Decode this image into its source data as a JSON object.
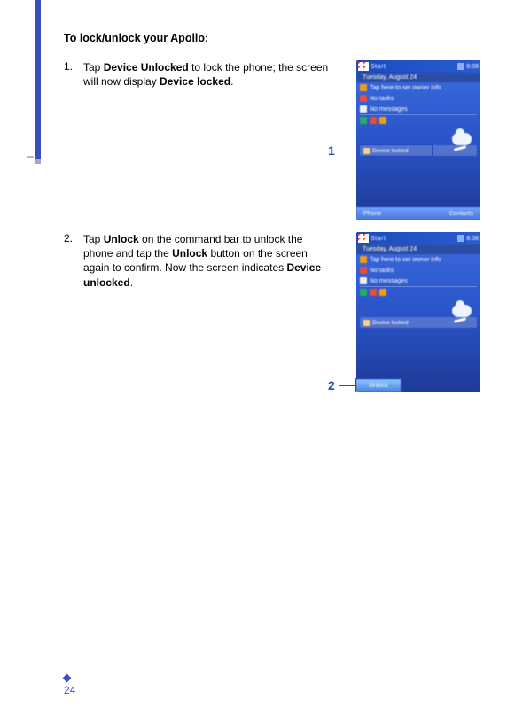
{
  "title": "To lock/unlock your Apollo:",
  "steps": [
    {
      "num": "1.",
      "body_parts": [
        "Tap ",
        "Device Unlocked",
        " to lock the phone; the screen will now display ",
        "Device locked",
        "."
      ],
      "bold_map": [
        false,
        true,
        false,
        true,
        false
      ],
      "callout": "1"
    },
    {
      "num": "2.",
      "body_parts": [
        "Tap ",
        "Unlock",
        " on the command bar to unlock the phone and tap the ",
        "Unlock",
        " button on the screen again to confirm. Now the screen indicates ",
        "Device unlocked",
        "."
      ],
      "bold_map": [
        false,
        true,
        false,
        true,
        false,
        true,
        false
      ],
      "callout": "2"
    }
  ],
  "page_number": "24",
  "screenshots": {
    "titlebar_text": "Start",
    "clock": "8:08",
    "lock_label_1": "Device locked",
    "bottom_left_1": "Phone",
    "bottom_right_1": "Contacts",
    "unlock_btn": "Unlock"
  }
}
